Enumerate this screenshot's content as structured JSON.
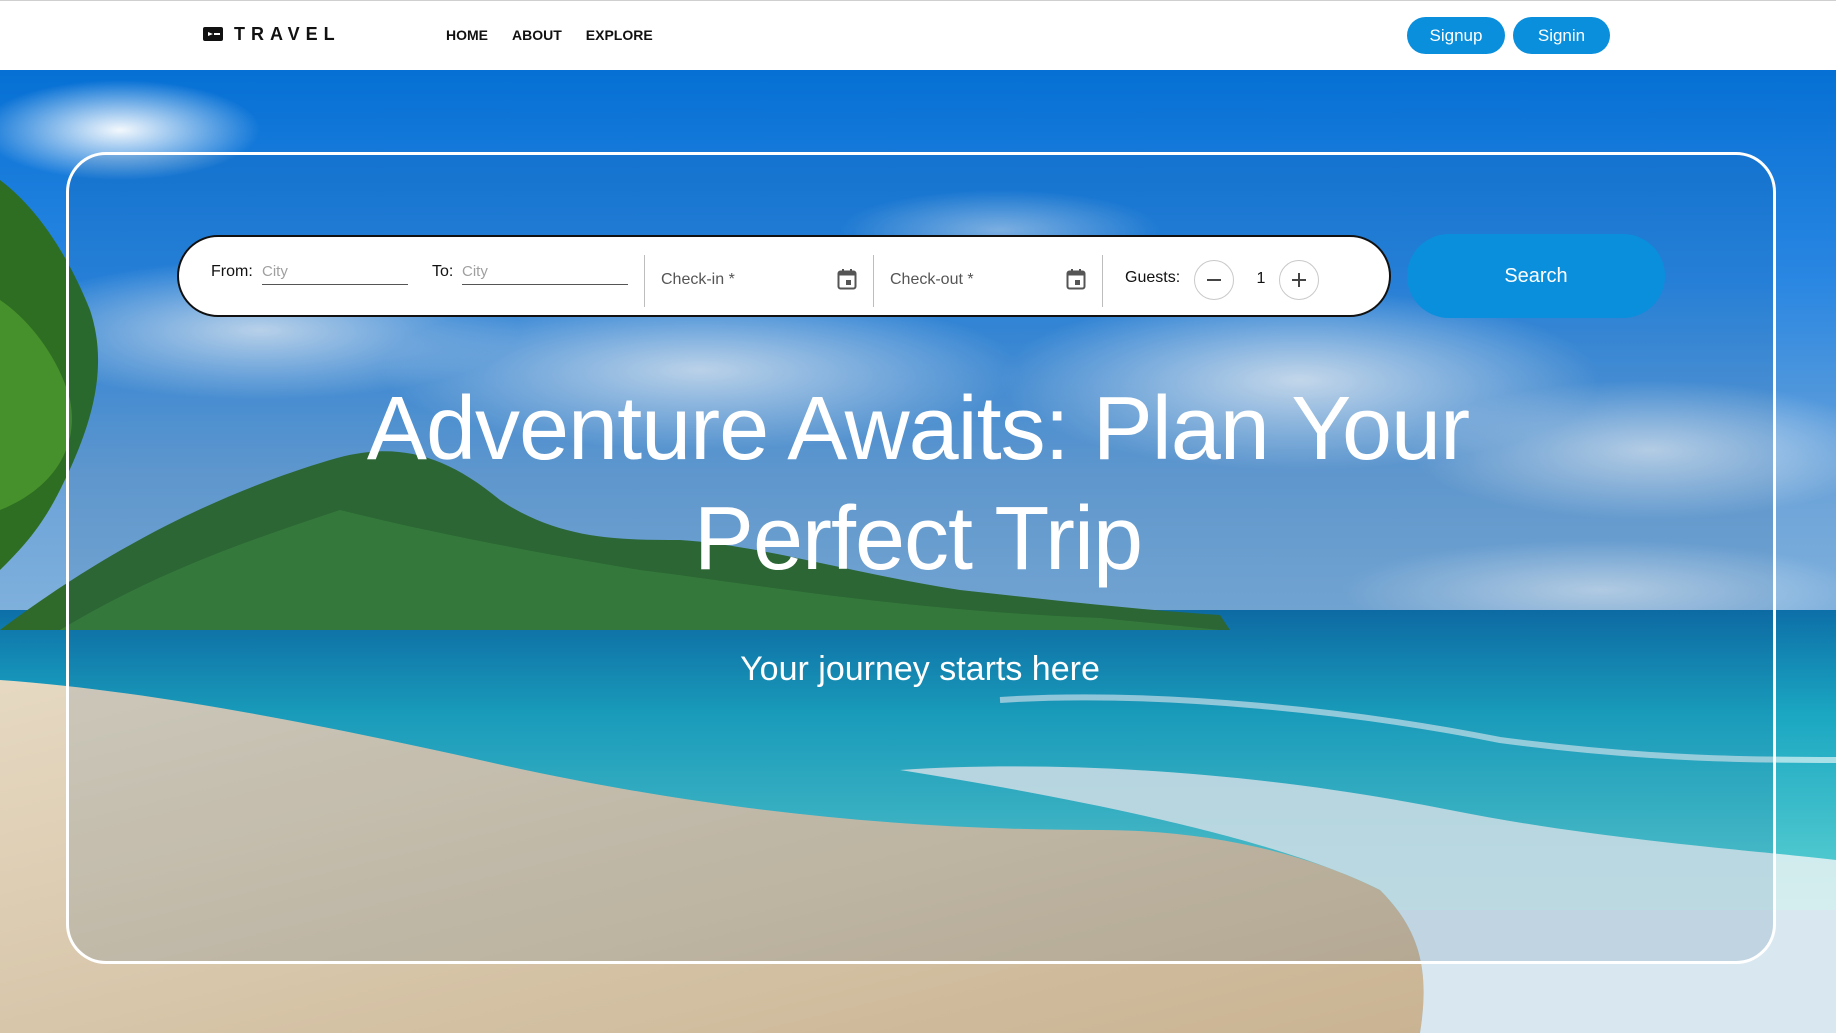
{
  "brand": {
    "name": "TRAVEL",
    "icon": "ticket-icon"
  },
  "nav": {
    "links": [
      {
        "label": "HOME"
      },
      {
        "label": "ABOUT"
      },
      {
        "label": "EXPLORE"
      }
    ],
    "signup_label": "Signup",
    "signin_label": "Signin"
  },
  "search": {
    "from_label": "From:",
    "from_placeholder": "City",
    "to_label": "To:",
    "to_placeholder": "City",
    "checkin_label": "Check-in *",
    "checkout_label": "Check-out *",
    "guests_label": "Guests:",
    "guests_value": "1",
    "search_label": "Search"
  },
  "hero": {
    "title": "Adventure Awaits: Plan Your Perfect Trip",
    "subtitle": "Your journey starts here"
  },
  "colors": {
    "accent": "#0a8fdc",
    "nav_background": "#ffffff",
    "hero_text": "#ffffff"
  }
}
